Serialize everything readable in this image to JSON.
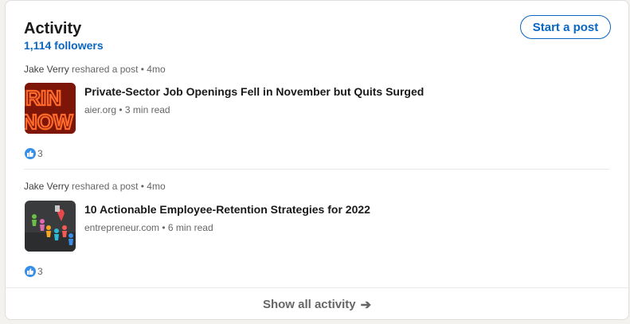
{
  "activity": {
    "title": "Activity",
    "followers": "1,114 followers",
    "start_post_label": "Start a post"
  },
  "posts": [
    {
      "author": "Jake Verry",
      "meta": "reshared a post • 4mo",
      "title": "Private-Sector Job Openings Fell in November but Quits Surged",
      "source": "aier.org • 3 min read",
      "likes": "3",
      "thumb_text": "IRIN NOW"
    },
    {
      "author": "Jake Verry",
      "meta": "reshared a post • 4mo",
      "title": "10 Actionable Employee-Retention Strategies for 2022",
      "source": "entrepreneur.com • 6 min read",
      "likes": "3"
    }
  ],
  "footer": {
    "show_all_label": "Show all activity",
    "arrow_icon": "arrow-right-icon"
  },
  "colors": {
    "accent": "#0a66c2",
    "like_blue": "#378fe9"
  }
}
